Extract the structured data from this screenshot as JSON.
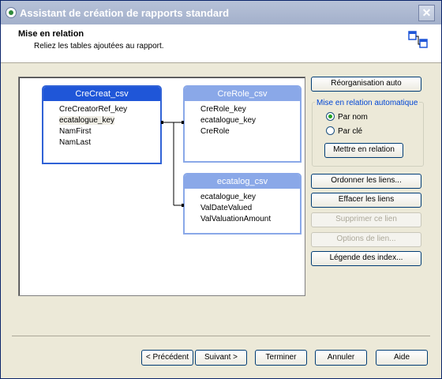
{
  "window": {
    "title": "Assistant de création de rapports standard",
    "close_label": "✕"
  },
  "header": {
    "title": "Mise en relation",
    "subtitle": "Reliez les tables ajoutées au rapport."
  },
  "tables": [
    {
      "name": "CreCreat_csv",
      "fields": [
        "CreCreatorRef_key",
        "ecatalogue_key",
        "NamFirst",
        "NamLast"
      ]
    },
    {
      "name": "CreRole_csv",
      "fields": [
        "CreRole_key",
        "ecatalogue_key",
        "CreRole"
      ]
    },
    {
      "name": "ecatalog_csv",
      "fields": [
        "ecatalogue_key",
        "ValDateValued",
        "ValValuationAmount"
      ]
    }
  ],
  "buttons": {
    "reorganize": "Réorganisation auto",
    "link": "Mettre en relation",
    "order_links": "Ordonner les liens...",
    "clear_links": "Effacer les liens",
    "delete_link": "Supprimer ce lien",
    "link_options": "Options de lien...",
    "index_legend": "Légende des index..."
  },
  "auto_link": {
    "legend": "Mise en relation automatique",
    "by_name": "Par nom",
    "by_key": "Par clé",
    "selected": "by_name"
  },
  "footer": {
    "previous": "< Précédent",
    "next": "Suivant >",
    "finish": "Terminer",
    "cancel": "Annuler",
    "help": "Aide"
  }
}
